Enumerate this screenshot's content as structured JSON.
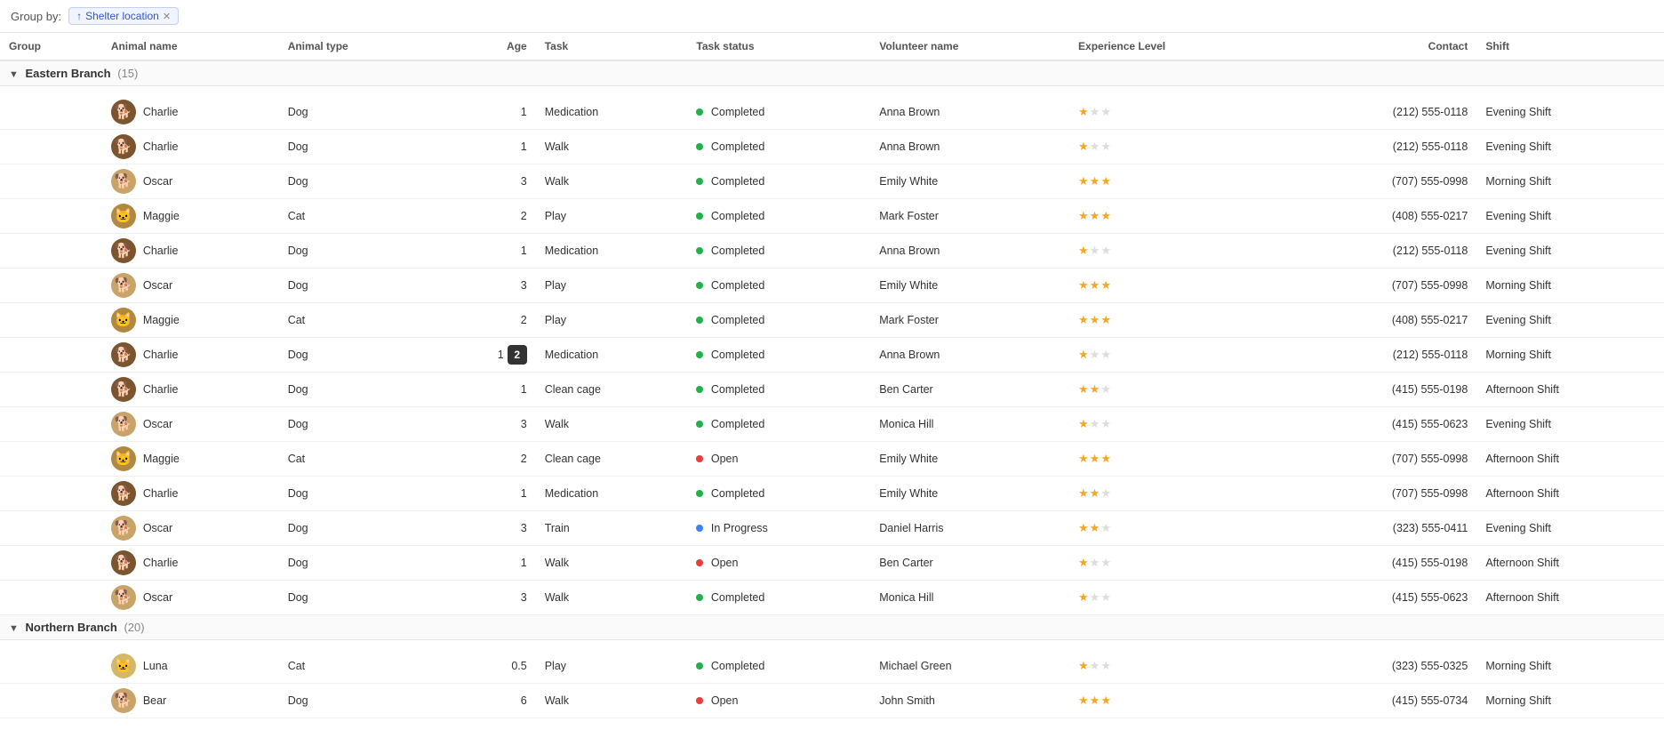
{
  "groupBy": {
    "label": "Group by:",
    "tag": {
      "icon": "↑",
      "text": "Shelter location"
    }
  },
  "columns": [
    {
      "id": "group",
      "label": "Group"
    },
    {
      "id": "animalName",
      "label": "Animal name"
    },
    {
      "id": "animalType",
      "label": "Animal type"
    },
    {
      "id": "age",
      "label": "Age"
    },
    {
      "id": "task",
      "label": "Task"
    },
    {
      "id": "taskStatus",
      "label": "Task status"
    },
    {
      "id": "volunteerName",
      "label": "Volunteer name"
    },
    {
      "id": "experienceLevel",
      "label": "Experience Level"
    },
    {
      "id": "contact",
      "label": "Contact"
    },
    {
      "id": "shift",
      "label": "Shift"
    }
  ],
  "groups": [
    {
      "name": "Eastern Branch",
      "count": 15,
      "rows": [
        {
          "animalName": "Charlie",
          "avatarType": "dog-dark",
          "emoji": "🐕",
          "animalType": "Dog",
          "age": 1,
          "task": "Medication",
          "taskStatus": "Completed",
          "taskStatusType": "green",
          "volunteerName": "Anna Brown",
          "stars": 1,
          "contact": "(212) 555-0118",
          "shift": "Evening Shift"
        },
        {
          "animalName": "Charlie",
          "avatarType": "dog-dark",
          "emoji": "🐕",
          "animalType": "Dog",
          "age": 1,
          "task": "Walk",
          "taskStatus": "Completed",
          "taskStatusType": "green",
          "volunteerName": "Anna Brown",
          "stars": 1,
          "contact": "(212) 555-0118",
          "shift": "Evening Shift"
        },
        {
          "animalName": "Oscar",
          "avatarType": "dog",
          "emoji": "🐶",
          "animalType": "Dog",
          "age": 3,
          "task": "Walk",
          "taskStatus": "Completed",
          "taskStatusType": "green",
          "volunteerName": "Emily White",
          "stars": 3,
          "contact": "(707) 555-0998",
          "shift": "Morning Shift"
        },
        {
          "animalName": "Maggie",
          "avatarType": "cat-dark",
          "emoji": "🐱",
          "animalType": "Cat",
          "age": 2,
          "task": "Play",
          "taskStatus": "Completed",
          "taskStatusType": "green",
          "volunteerName": "Mark Foster",
          "stars": 3,
          "contact": "(408) 555-0217",
          "shift": "Evening Shift"
        },
        {
          "animalName": "Charlie",
          "avatarType": "dog-dark",
          "emoji": "🐕",
          "animalType": "Dog",
          "age": 1,
          "task": "Medication",
          "taskStatus": "Completed",
          "taskStatusType": "green",
          "volunteerName": "Anna Brown",
          "stars": 1,
          "contact": "(212) 555-0118",
          "shift": "Evening Shift"
        },
        {
          "animalName": "Oscar",
          "avatarType": "dog",
          "emoji": "🐶",
          "animalType": "Dog",
          "age": 3,
          "task": "Play",
          "taskStatus": "Completed",
          "taskStatusType": "green",
          "volunteerName": "Emily White",
          "stars": 3,
          "contact": "(707) 555-0998",
          "shift": "Morning Shift"
        },
        {
          "animalName": "Maggie",
          "avatarType": "cat-dark",
          "emoji": "🐱",
          "animalType": "Cat",
          "age": 2,
          "task": "Play",
          "taskStatus": "Completed",
          "taskStatusType": "green",
          "volunteerName": "Mark Foster",
          "stars": 3,
          "contact": "(408) 555-0217",
          "shift": "Evening Shift"
        },
        {
          "animalName": "Charlie",
          "avatarType": "dog-dark",
          "emoji": "🐕",
          "animalType": "Dog",
          "age": 1,
          "task": "Medication",
          "taskStatus": "Completed",
          "taskStatusType": "green",
          "volunteerName": "Anna Brown",
          "stars": 1,
          "contact": "(212) 555-0118",
          "shift": "Morning Shift",
          "tooltip": "2"
        },
        {
          "animalName": "Charlie",
          "avatarType": "dog-dark",
          "emoji": "🐕",
          "animalType": "Dog",
          "age": 1,
          "task": "Clean cage",
          "taskStatus": "Completed",
          "taskStatusType": "green",
          "volunteerName": "Ben Carter",
          "stars": 2,
          "contact": "(415) 555-0198",
          "shift": "Afternoon Shift"
        },
        {
          "animalName": "Oscar",
          "avatarType": "dog",
          "emoji": "🐶",
          "animalType": "Dog",
          "age": 3,
          "task": "Walk",
          "taskStatus": "Completed",
          "taskStatusType": "green",
          "volunteerName": "Monica Hill",
          "stars": 1,
          "contact": "(415) 555-0623",
          "shift": "Evening Shift"
        },
        {
          "animalName": "Maggie",
          "avatarType": "cat-dark",
          "emoji": "🐱",
          "animalType": "Cat",
          "age": 2,
          "task": "Clean cage",
          "taskStatus": "Open",
          "taskStatusType": "red",
          "volunteerName": "Emily White",
          "stars": 3,
          "contact": "(707) 555-0998",
          "shift": "Afternoon Shift"
        },
        {
          "animalName": "Charlie",
          "avatarType": "dog-dark",
          "emoji": "🐕",
          "animalType": "Dog",
          "age": 1,
          "task": "Medication",
          "taskStatus": "Completed",
          "taskStatusType": "green",
          "volunteerName": "Emily White",
          "stars": 2,
          "contact": "(707) 555-0998",
          "shift": "Afternoon Shift"
        },
        {
          "animalName": "Oscar",
          "avatarType": "dog",
          "emoji": "🐶",
          "animalType": "Dog",
          "age": 3,
          "task": "Train",
          "taskStatus": "In Progress",
          "taskStatusType": "blue",
          "volunteerName": "Daniel Harris",
          "stars": 2,
          "contact": "(323) 555-0411",
          "shift": "Evening Shift"
        },
        {
          "animalName": "Charlie",
          "avatarType": "dog-dark",
          "emoji": "🐕",
          "animalType": "Dog",
          "age": 1,
          "task": "Walk",
          "taskStatus": "Open",
          "taskStatusType": "red",
          "volunteerName": "Ben Carter",
          "stars": 1,
          "contact": "(415) 555-0198",
          "shift": "Afternoon Shift"
        },
        {
          "animalName": "Oscar",
          "avatarType": "dog",
          "emoji": "🐶",
          "animalType": "Dog",
          "age": 3,
          "task": "Walk",
          "taskStatus": "Completed",
          "taskStatusType": "green",
          "volunteerName": "Monica Hill",
          "stars": 1,
          "contact": "(415) 555-0623",
          "shift": "Afternoon Shift"
        }
      ]
    },
    {
      "name": "Northern Branch",
      "count": 20,
      "rows": [
        {
          "animalName": "Luna",
          "avatarType": "cat",
          "emoji": "🐱",
          "animalType": "Cat",
          "age": 0.5,
          "task": "Play",
          "taskStatus": "Completed",
          "taskStatusType": "green",
          "volunteerName": "Michael Green",
          "stars": 1,
          "contact": "(323) 555-0325",
          "shift": "Morning Shift"
        },
        {
          "animalName": "Bear",
          "avatarType": "dog",
          "emoji": "🐶",
          "animalType": "Dog",
          "age": 6,
          "task": "Walk",
          "taskStatus": "Open",
          "taskStatusType": "red",
          "volunteerName": "John Smith",
          "stars": 3,
          "contact": "(415) 555-0734",
          "shift": "Morning Shift"
        }
      ]
    }
  ]
}
